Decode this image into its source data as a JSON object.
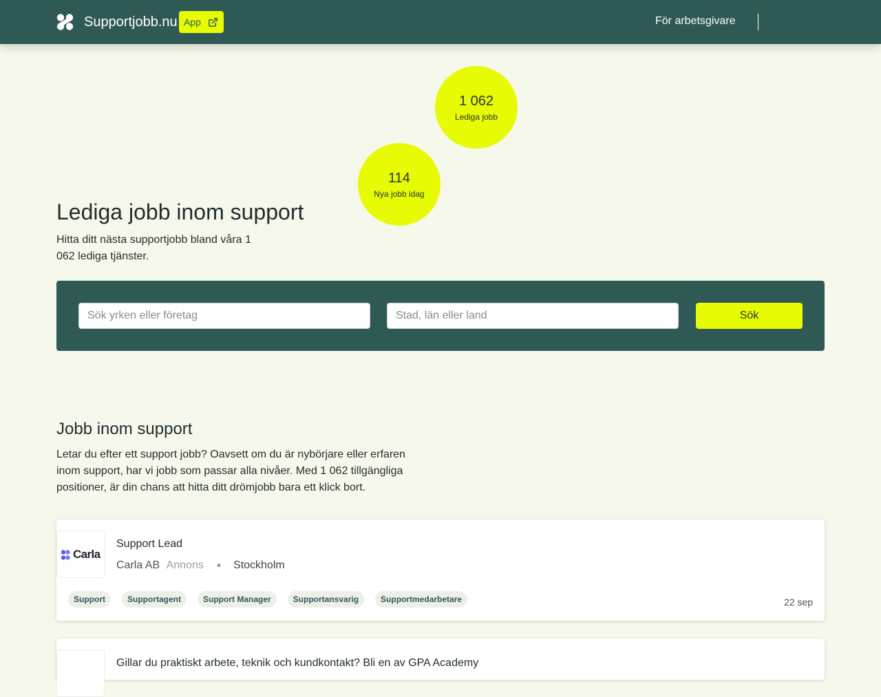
{
  "header": {
    "site_name": "Supportjobb.nu",
    "app_label": "App",
    "nav_employers": "För arbetsgivare"
  },
  "stats": [
    {
      "value": "1 062",
      "label": "Lediga jobb"
    },
    {
      "value": "114",
      "label": "Nya jobb idag"
    }
  ],
  "hero": {
    "title": "Lediga jobb inom support",
    "subtitle": "Hitta ditt nästa supportjobb bland våra 1 062 lediga tjänster."
  },
  "search": {
    "query_placeholder": "Sök yrken eller företag",
    "location_placeholder": "Stad, län eller land",
    "button_label": "Sök"
  },
  "section": {
    "title": "Jobb inom support",
    "description": "Letar du efter ett support jobb? Oavsett om du är nybörjare eller erfaren inom support, har vi jobb som passar alla nivåer. Med 1 062 tillgängliga positioner, är din chans att hitta ditt drömjobb bara ett klick bort."
  },
  "jobs": [
    {
      "logo_text": "Carla",
      "title": "Support Lead",
      "company": "Carla AB",
      "ad_label": "Annons",
      "location": "Stockholm",
      "tags": [
        "Support",
        "Supportagent",
        "Support Manager",
        "Supportansvarig",
        "Supportmedarbetare"
      ],
      "date": "22 sep"
    },
    {
      "title": "Gillar du praktiskt arbete, teknik och kundkontakt? Bli en av GPA Academy"
    }
  ],
  "colors": {
    "header_bg": "#2f5954",
    "accent": "#e6fb04",
    "page_bg": "#f7f8ec"
  }
}
